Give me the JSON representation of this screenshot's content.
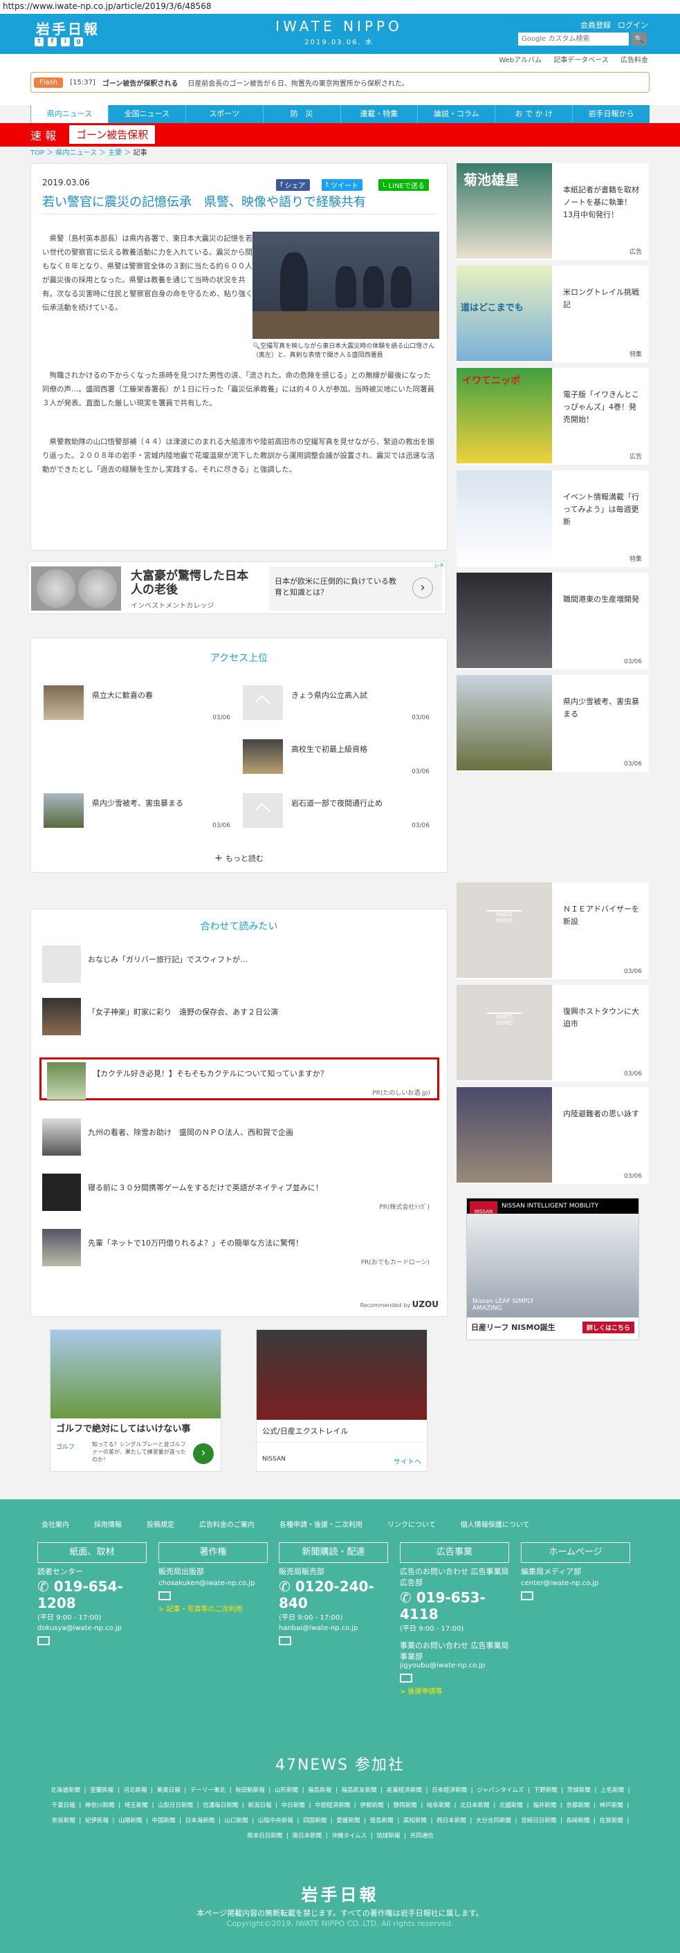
{
  "url": "https://www.iwate-np.co.jp/article/2019/3/6/48568",
  "header": {
    "logo": "岩手日報",
    "social": [
      "t",
      "f",
      "i",
      "g"
    ],
    "masthead": "IWATE NIPPO",
    "date": "2019.03.06. 水",
    "links": [
      "会員登録",
      "ログイン"
    ],
    "search_placeholder": "Google カスタム検索",
    "search_icon": "🔍"
  },
  "sublinks": [
    "Webアルバム",
    "記事データベース",
    "広告料金"
  ],
  "flash": {
    "label": "Flash",
    "time": "[15:37]",
    "headline": "ゴーン被告が保釈される",
    "text": "日産前会長のゴーン被告が６日、拘置先の東京拘置所から保釈された。"
  },
  "nav": [
    "県内ニュース",
    "全国ニュース",
    "スポーツ",
    "防　災",
    "連載・特集",
    "論説・コラム",
    "お で か け",
    "岩手日報から"
  ],
  "ticker": {
    "label": "速 報",
    "text": "ゴーン被告保釈"
  },
  "breadcrumb": [
    "TOP",
    "県内ニュース",
    "主要",
    "記事"
  ],
  "article": {
    "date": "2019.03.06",
    "share": [
      "シェア",
      "ツイート",
      "LINEで送る"
    ],
    "title": "若い警官に震災の記憶伝承　県警、映像や語りで経験共有",
    "p1": "県警（島村英本部長）は県内各署で、東日本大震災の記憶を若い世代の警察官に伝える教養活動に力を入れている。震災から間もなく８年となり、県警は警察官全体の３割に当たる約６００人が震災後の採用となった。県警は教養を通じて当時の状況を共有。次なる災害時に住民と警察官自身の命を守るため、粘り強く伝承活動を続けている。",
    "p2": "殉職されかけるの下からくなった孫時を見つけた男性の涙、「流された。命の危険を感じる」との無線が最後になった同僚の声…。盛岡西署（工藤栄香署長）が１日に行った「震災伝承教養」には約４０人が参加。当時被災地にいた同署員３人が発表。直面した厳しい現実を署員で共有した。",
    "p3": "県警救助隊の山口悟警部補（４４）は津波にのまれる大船渡市や陸前高田市の空撮写真を見せながら、緊迫の救出を振り返った。２００８年の岩手・宮城内陸地震で花壇温泉が流下した教訓から運用調整会議が設置され、震災では迅速な活動ができたとし「過去の経験を生かし実践する。それに尽きる」と強調した。",
    "caption": "空撮写真を映しながら東日本大震災時の体験を語る山口悟さん（奥左）と、真剣な表情で聞き入る盛岡西署員"
  },
  "ad1": {
    "headline": "大富豪が驚愕した日本人の老後",
    "sub": "インベストメントカレッジ",
    "right": "日本が欧米に圧倒的に負けている教育と知識とは？",
    "arrow": "›",
    "badge": "▷✕"
  },
  "ranking": {
    "title": "アクセス上位",
    "items": [
      {
        "title": "県立大に歓喜の春",
        "date": "03/06"
      },
      {
        "title": "きょう県内公立高入試",
        "date": "03/06"
      },
      {
        "title": "高校生で初最上級資格",
        "date": "03/06"
      },
      {
        "title": "県内少雪被考、害虫暴まる",
        "date": "03/06"
      },
      {
        "title": "岩石道一部で夜間通行止め",
        "date": "03/06"
      }
    ],
    "more": "もっと読む"
  },
  "related": {
    "title": "合わせて読みたい",
    "items": [
      {
        "title": "おなじみ「ガリバー旅行記」でスウィフトが…",
        "pr": ""
      },
      {
        "title": "「女子神楽」町家に彩り　遠野の保存会、あす２日公演",
        "pr": ""
      },
      {
        "title": "【カクテル好き必見！】そもそもカクテルについて知っていますか？",
        "pr": "PR(たのしいお酒.jp)"
      },
      {
        "title": "九州の看者、除雪お助け　盛岡のＮＰＯ法人、西和賀で企画",
        "pr": ""
      },
      {
        "title": "寝る前に３０分間携帯ゲームをするだけで英語がネイティブ並みに！",
        "pr": "PR(株式会社ﾄﾘｶﾞ)"
      },
      {
        "title": "先輩「ネットで10万円借りれるよ？」その簡単な方法に驚愕！",
        "pr": "PR(おでもカードローン)"
      }
    ],
    "recommended": "Recommended by",
    "uzou": "UZOU"
  },
  "ads_bottom": [
    {
      "title": "ゴルフで絶対にしてはいけない事",
      "sub": "知ってる？シングルプレーと並ゴルファーの差が、果たして練習量が違ったのか！",
      "brand": "ゴルフ",
      "arrow": "›"
    },
    {
      "title": "公式/日産エクストレイル",
      "brand": "NISSAN",
      "link": "サイトへ"
    }
  ],
  "sidebar": [
    {
      "title": "本紙記者が書籍を取材ノートを基に執筆！ 13月中旬発行！",
      "tag": "広告",
      "banner": "菊池雄星"
    },
    {
      "title": "米ロングトレイル挑戦記",
      "tag": "特集",
      "banner": "道はどこまでも"
    },
    {
      "title": "電子版「イワきんとこっぴゃんズ」4巻！発売開始！",
      "tag": "広告",
      "banner": "イワてニッポ"
    },
    {
      "title": "イベント情報満載「行ってみよう」は毎週更新",
      "tag": "特集"
    },
    {
      "title": "職間港東の生産増開発",
      "tag": "03/06"
    },
    {
      "title": "県内少雪被考、害虫暴まる",
      "tag": "03/06"
    },
    {
      "title": "ＮＩＥアドバイザーを新設",
      "tag": "03/06"
    },
    {
      "title": "復興ホストタウンに大迫市",
      "tag": "03/06"
    },
    {
      "title": "内陸避難者の思い詠す",
      "tag": "03/06"
    }
  ],
  "nissan_ad": {
    "brand": "NISSAN",
    "tagline": "NISSAN INTELLIGENT MOBILITY",
    "car": "Nissan LEAF SIMPLY AMAZING",
    "cap": "日産リーフ NISMO誕生",
    "btn": "詳しくはこちら"
  },
  "footer": {
    "links": [
      "会社案内",
      "採用情報",
      "投稿規定",
      "広告料金のご案内",
      "各種申請・後援・二次利用",
      "リンクについて",
      "個人情報保護について"
    ],
    "cols": [
      {
        "head": "紙面、取材",
        "l1": "読者センター",
        "tel": "019-654-1208",
        "hours": "(平日 9:00 - 17:00)",
        "mail": "dokusya@iwate-np.co.jp"
      },
      {
        "head": "著作権",
        "l1": "販売局出版部",
        "mail": "chosakuken@iwate-np.co.jp",
        "y": "> 記事・写真等の二次利用"
      },
      {
        "head": "新聞購読・配達",
        "l1": "販売局販売部",
        "tel": "0120-240-840",
        "hours": "(平日 9:00 - 17:00)",
        "mail": "hanbai@iwate-np.co.jp"
      },
      {
        "head": "広告事業",
        "l1": "広告のお問い合わせ 広告事業局広告部",
        "tel": "019-653-4118",
        "hours": "(平日 9:00 - 17:00)",
        "l2": "事業のお問い合わせ 広告事業局事業部",
        "mail": "jigyoubu@iwate-np.co.jp",
        "y": "> 後援申請等"
      },
      {
        "head": "ホームページ",
        "l1": "編集局メディア部",
        "mail": "center@iwate-np.co.jp"
      }
    ],
    "news47": "47NEWS 参加社",
    "papers": "北海道新聞 | 室蘭民報 | 河北新報 | 東奥日報 | デーリー東北 | 秋田魁新報 | 山形新聞 | 福島民報 | 福島民友新聞 | 産業経済新聞 | 日本経済新聞 | ジャパンタイムズ | 下野新聞 | 茨城新聞 | 上毛新聞 | 千葉日報 | 神奈川新聞 | 埼玉新聞 | 山梨日日新聞 | 信濃毎日新聞 | 新潟日報 | 中日新聞 | 中部経済新聞 | 伊勢新聞 | 静岡新聞 | 岐阜新聞 | 北日本新聞 | 北國新聞 | 福井新聞 | 京都新聞 | 神戸新聞 | 奈良新聞 | 紀伊民報 | 山陽新聞 | 中国新聞 | 日本海新聞 | 山口新聞 | 山陰中央新報 | 四国新聞 | 愛媛新聞 | 徳島新聞 | 高知新聞 | 西日本新聞 | 大分合同新聞 | 宮崎日日新聞 | 長崎新聞 | 佐賀新聞 | 熊本日日新聞 | 南日本新聞 | 沖縄タイムス | 琉球新報 | 共同通信",
    "logo": "岩手日報",
    "copy": "本ページ掲載内容の無断転載を禁じます。すべての著作権は岩手日報社に属します。",
    "copyright": "Copyright©2019, IWATE NIPPO CO.,LTD. All rights reserved."
  }
}
